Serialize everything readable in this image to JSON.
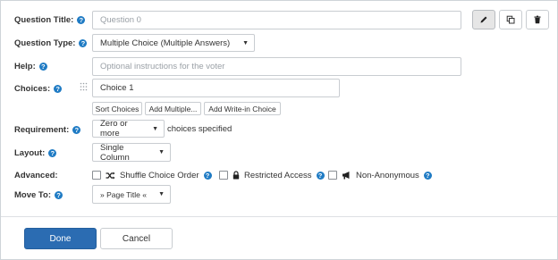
{
  "labels": {
    "question_title": "Question Title:",
    "question_type": "Question Type:",
    "help": "Help:",
    "choices": "Choices:",
    "requirement": "Requirement:",
    "layout": "Layout:",
    "advanced": "Advanced:",
    "move_to": "Move To:"
  },
  "help_icon_glyph": "?",
  "question_title": {
    "value": "",
    "placeholder": "Question 0"
  },
  "question_type": {
    "selected": "Multiple Choice (Multiple Answers)"
  },
  "help_field": {
    "value": "",
    "placeholder": "Optional instructions for the voter"
  },
  "choices": {
    "items": [
      {
        "label": "Choice 1"
      }
    ]
  },
  "choice_actions": {
    "sort": "Sort Choices",
    "add_multiple": "Add Multiple...",
    "add_write_in": "Add Write-in Choice"
  },
  "requirement": {
    "selected": "Zero or more",
    "suffix": "choices specified"
  },
  "layout": {
    "selected": "Single Column"
  },
  "advanced": {
    "shuffle": {
      "label": "Shuffle Choice Order",
      "checked": false,
      "icon": "shuffle-icon"
    },
    "restricted": {
      "label": "Restricted Access",
      "checked": false,
      "icon": "lock-icon"
    },
    "non_anonymous": {
      "label": "Non-Anonymous",
      "checked": false,
      "icon": "megaphone-icon"
    }
  },
  "move_to": {
    "selected": "» Page Title «"
  },
  "toolbar": {
    "edit_icon": "pencil-icon",
    "copy_icon": "copy-icon",
    "delete_icon": "trash-icon"
  },
  "footer": {
    "done": "Done",
    "cancel": "Cancel"
  },
  "colors": {
    "accent": "#2b6cb2",
    "help_icon": "#1f7bc4",
    "border": "#c9cdd1"
  }
}
